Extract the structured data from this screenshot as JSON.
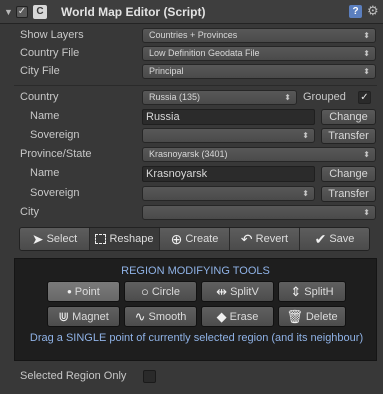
{
  "header": {
    "collapse_glyph": "▼",
    "enabled_check": "✓",
    "script_glyph": "C",
    "title": "World Map Editor (Script)",
    "help_glyph": "?",
    "gear_glyph": "⚙"
  },
  "settings": {
    "show_layers": {
      "label": "Show Layers",
      "value": "Countries + Provinces"
    },
    "country_file": {
      "label": "Country File",
      "value": "Low Definition Geodata File"
    },
    "city_file": {
      "label": "City File",
      "value": "Principal"
    }
  },
  "country": {
    "label": "Country",
    "value": "Russia (135)",
    "grouped_label": "Grouped",
    "grouped_check": "✓",
    "name_label": "Name",
    "name_value": "Russia",
    "change_label": "Change",
    "sovereign_label": "Sovereign",
    "sovereign_value": "",
    "transfer_label": "Transfer"
  },
  "province": {
    "label": "Province/State",
    "value": "Krasnoyarsk (3401)",
    "name_label": "Name",
    "name_value": "Krasnoyarsk",
    "change_label": "Change",
    "sovereign_label": "Sovereign",
    "sovereign_value": "",
    "transfer_label": "Transfer"
  },
  "city": {
    "label": "City",
    "value": ""
  },
  "toolbar": {
    "select": "Select",
    "reshape": "Reshape",
    "create": "Create",
    "revert": "Revert",
    "save": "Save"
  },
  "region_tools": {
    "title": "REGION MODIFYING TOOLS",
    "point": "Point",
    "circle": "Circle",
    "splitv": "SplitV",
    "splith": "SplitH",
    "magnet": "Magnet",
    "smooth": "Smooth",
    "erase": "Erase",
    "delete": "Delete",
    "hint": "Drag a SINGLE point of currently selected region (and its neighbour)"
  },
  "selected_region_only": {
    "label": "Selected Region Only",
    "checked": false
  },
  "colors": {
    "accent_text": "#8fb2e6",
    "background": "#383838",
    "panel": "#1e1e1e"
  }
}
